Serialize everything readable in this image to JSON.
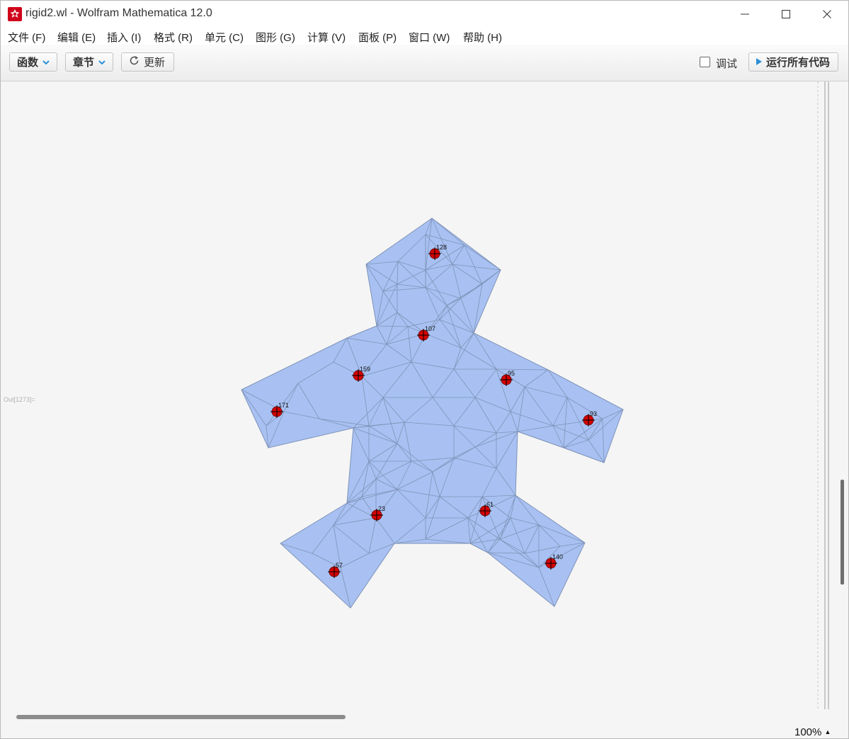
{
  "window": {
    "title": "rigid2.wl - Wolfram Mathematica 12.0",
    "app_icon": "mathematica-spikey-icon",
    "controls": [
      "minimize-icon",
      "maximize-icon",
      "close-icon"
    ]
  },
  "menu": {
    "items": [
      "文件 (F)",
      "编辑 (E)",
      "插入 (I)",
      "格式 (R)",
      "单元 (C)",
      "图形 (G)",
      "计算 (V)",
      "面板 (P)",
      "窗口 (W)",
      "帮助 (H)"
    ]
  },
  "toolbar": {
    "functions_label": "函数",
    "sections_label": "章节",
    "update_label": "更新",
    "debug_label": "调试",
    "debug_checked": false,
    "run_all_label": "运行所有代码"
  },
  "notebook": {
    "cell_label": "Out[1273]=",
    "mesh": {
      "fill_color": "#a8c1f2",
      "edge_color": "#7f93b8",
      "marker_color": "#d50000",
      "labeled_nodes": [
        "128",
        "107",
        "159",
        "95",
        "171",
        "93",
        "23",
        "61",
        "57",
        "140"
      ]
    }
  },
  "status": {
    "zoom": "100%"
  },
  "colors": {
    "background": "#f5f5f5",
    "accent": "#2a8fd6"
  }
}
